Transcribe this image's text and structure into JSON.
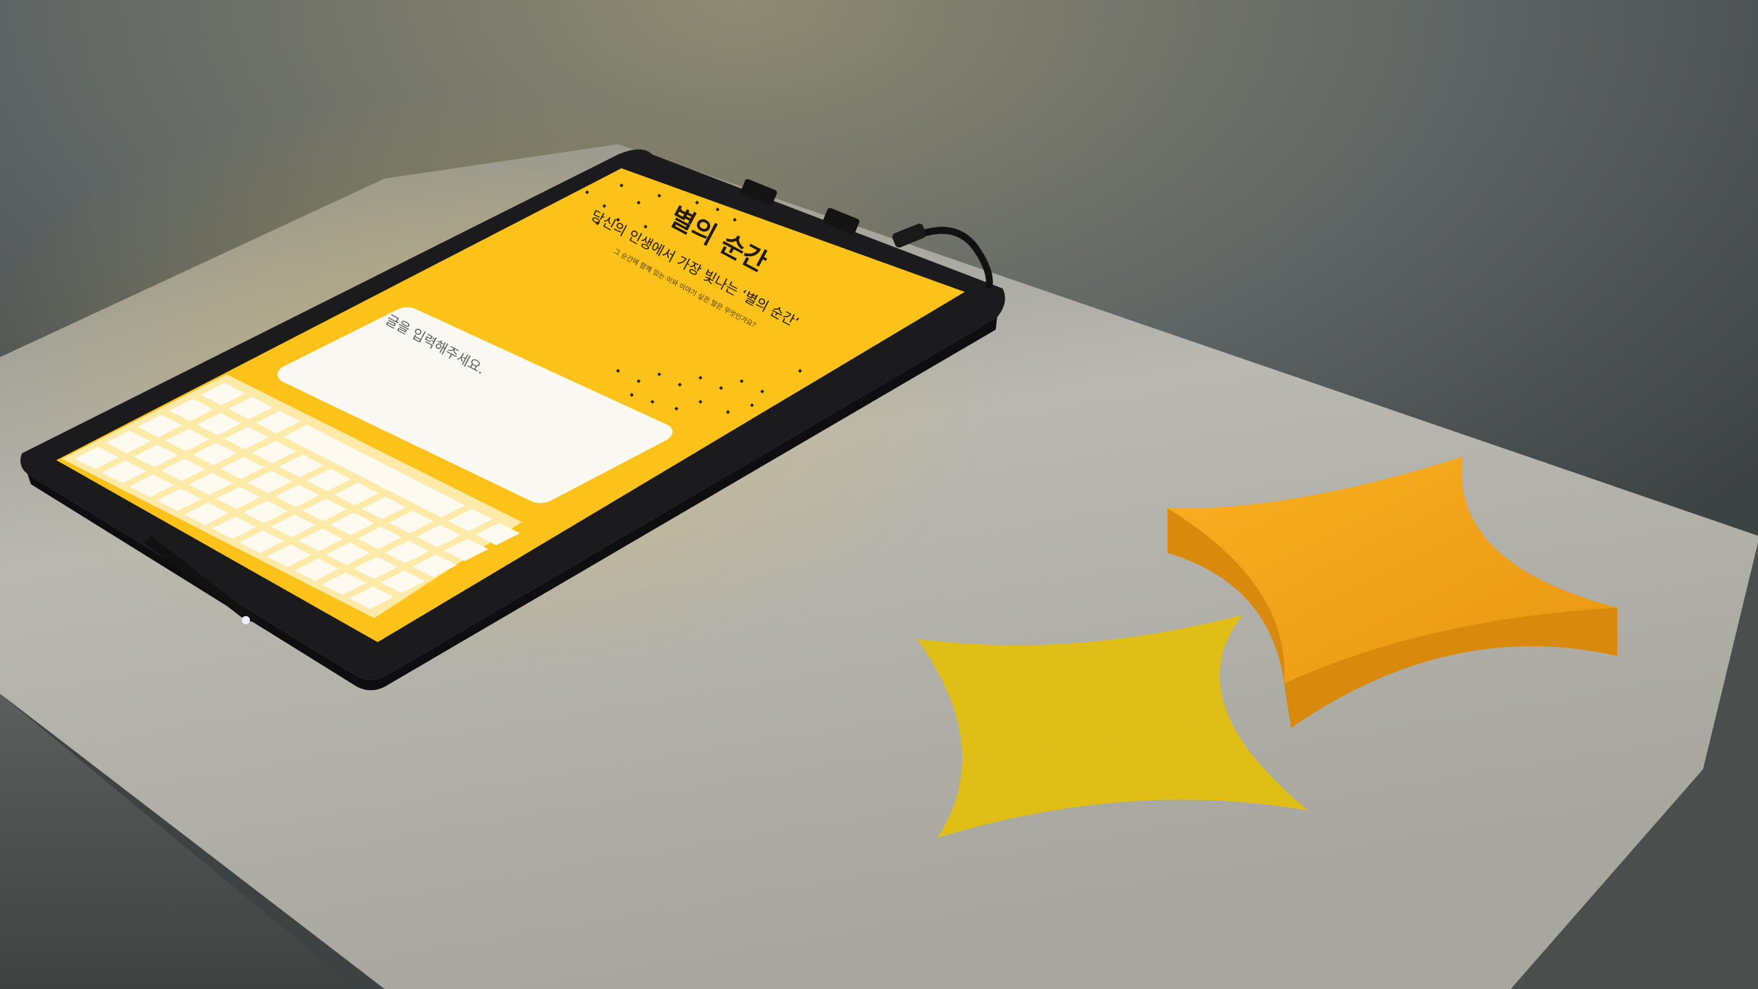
{
  "screen": {
    "headline": "별의 순간",
    "question": "당신의 인생에서 가장 빛나는 ‘별의 순간’",
    "hint": "그 순간에 함께 있는 이와 이야기 싶은 말은 무엇인가요?",
    "input_placeholder": "글을 입력해주세요."
  },
  "colors": {
    "wall": "#6b7372",
    "table_top": "#bebdb6",
    "table_front": "#555a58",
    "tablet_bezel": "#1d1d1f",
    "screen_yellow": "#fcc21a",
    "star_orange": "#f2a418",
    "star_shadow": "#e6c410"
  },
  "icons": {
    "sparkle_object": "four-point-star",
    "sparkle_projection": "four-point-star"
  }
}
